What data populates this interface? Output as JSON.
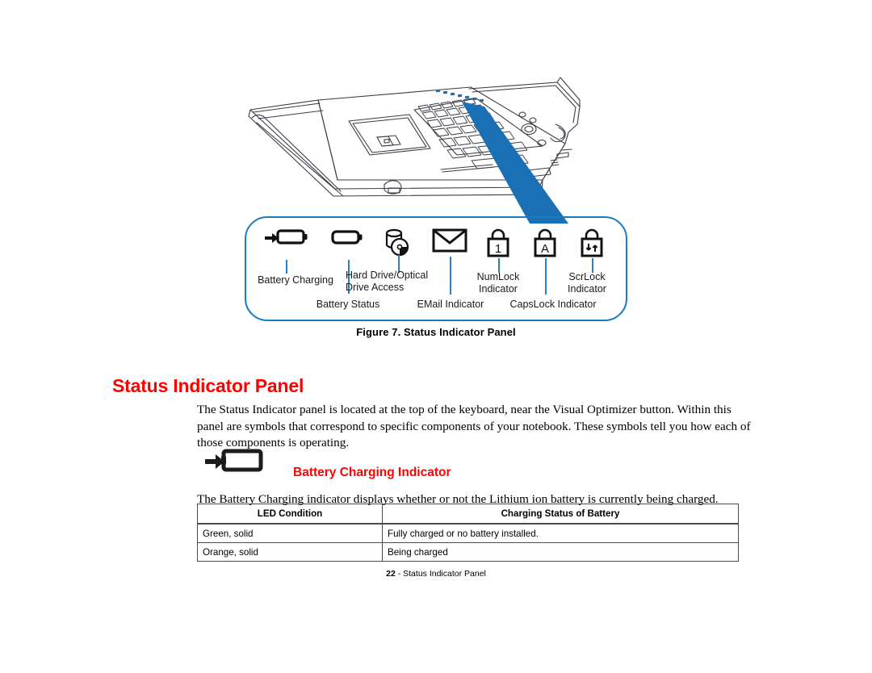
{
  "figure": {
    "caption": "Figure 7.  Status Indicator Panel",
    "panel_border_color": "#1a7cc0",
    "leader_line_color": "#2a7fc1",
    "indicators": [
      {
        "icon": "battery-charging-icon",
        "label": "Battery Charging"
      },
      {
        "icon": "battery-status-icon",
        "label": "Battery Status"
      },
      {
        "icon": "hard-drive-optical-access-icon",
        "label": "Hard Drive/Optical\nDrive Access"
      },
      {
        "icon": "email-envelope-icon",
        "label": "EMail Indicator"
      },
      {
        "icon": "numlock-padlock-icon",
        "label": "NumLock\nIndicator"
      },
      {
        "icon": "capslock-padlock-icon",
        "label": "CapsLock Indicator"
      },
      {
        "icon": "scrlock-padlock-icon",
        "label": "ScrLock\nIndicator"
      }
    ],
    "illustration": {
      "name": "notebook-computer-line-drawing",
      "callout_color": "#1a6fb5"
    }
  },
  "section": {
    "heading": "Status Indicator Panel",
    "heading_color": "#fe0000",
    "intro_paragraph": "The Status Indicator panel is located at the top of the keyboard, near the Visual Optimizer button. Within this panel are symbols  that correspond to specific components of your notebook. These symbols tell you how each of those components is operating."
  },
  "subsection": {
    "icon": "battery-charging-icon",
    "heading": "Battery Charging Indicator",
    "heading_color": "#fe0000",
    "paragraph": "The Battery Charging indicator displays whether or not the Lithium ion battery is currently being charged."
  },
  "table": {
    "columns": [
      "LED Condition",
      "Charging Status of Battery"
    ],
    "rows": [
      [
        "Green, solid",
        "Fully charged or no battery installed."
      ],
      [
        "Orange, solid",
        "Being charged"
      ]
    ]
  },
  "footer": {
    "page_number": "22",
    "separator": " - ",
    "title": "Status Indicator Panel"
  }
}
